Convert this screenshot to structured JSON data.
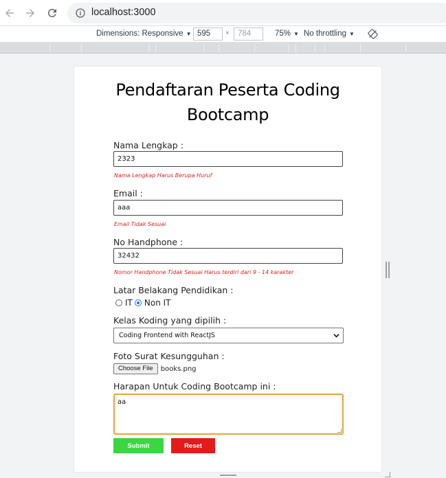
{
  "browser": {
    "url": "localhost:3000",
    "back_icon": "arrow-left-icon",
    "forward_icon": "arrow-right-icon",
    "reload_icon": "reload-icon",
    "info_icon": "info-icon"
  },
  "devtools": {
    "dimensions_label": "Dimensions: Responsive",
    "width": "595",
    "height": "784",
    "times": "×",
    "zoom": "75%",
    "throttling": "No throttling",
    "rotate_icon": "rotate-icon"
  },
  "form": {
    "title": "Pendaftaran Peserta Coding Bootcamp",
    "nama": {
      "label": "Nama Lengkap :",
      "value": "2323",
      "error": "Nama Lengkap Harus Berupa Huruf"
    },
    "email": {
      "label": "Email :",
      "value": "aaa",
      "error": "Email Tidak Sesuai"
    },
    "phone": {
      "label": "No Handphone :",
      "value": "32432",
      "error": "Nomor Handphone Tidak Sesuai Harus terdiri dari 9 - 14 karakter"
    },
    "pendidikan": {
      "label": "Latar Belakang Pendidikan :",
      "options": [
        "IT",
        "Non IT"
      ],
      "selected": "Non IT"
    },
    "kelas": {
      "label": "Kelas Koding yang dipilih :",
      "selected": "Coding Frontend with ReactJS"
    },
    "foto": {
      "label": "Foto Surat Kesungguhan :",
      "button": "Choose File",
      "filename": "books.png"
    },
    "harapan": {
      "label": "Harapan Untuk Coding Bootcamp ini :",
      "value": "aa"
    },
    "submit_label": "Submit",
    "reset_label": "Reset",
    "colors": {
      "submit": "#3bd640",
      "reset": "#e41b1b",
      "error": "#e0201f",
      "focus": "#e8a33d"
    }
  }
}
